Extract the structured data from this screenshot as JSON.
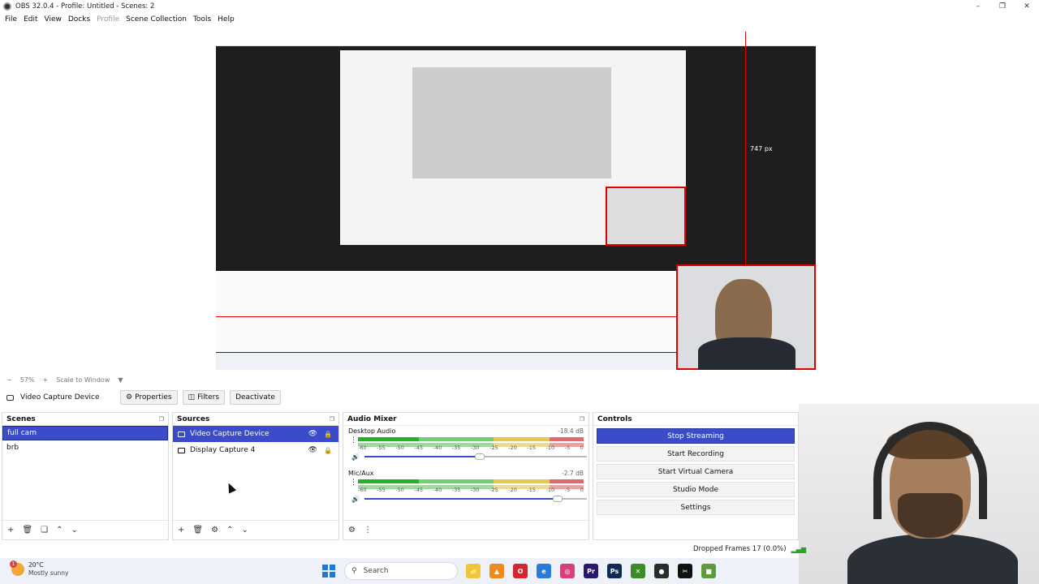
{
  "window": {
    "title": "OBS 32.0.4 - Profile: Untitled - Scenes: 2",
    "controls": [
      "–",
      "❐",
      "✕"
    ]
  },
  "menu": {
    "items": [
      "File",
      "Edit",
      "View",
      "Docks",
      "Profile",
      "Scene Collection",
      "Tools",
      "Help"
    ]
  },
  "preview": {
    "measure_label": "747 px"
  },
  "zoom_bar": {
    "minus": "−",
    "zoom": "57%",
    "plus": "+",
    "mode": "Scale to Window",
    "arrow": "▼"
  },
  "source_toolbar": {
    "source_name": "Video Capture Device",
    "properties": "Properties",
    "filters": "Filters",
    "deactivate": "Deactivate"
  },
  "scenes": {
    "title": "Scenes",
    "items": [
      "full cam",
      "brb"
    ],
    "footer": [
      "+",
      "🗑",
      "❏",
      "⌃",
      "⌄"
    ]
  },
  "sources": {
    "title": "Sources",
    "items": [
      "Video Capture Device",
      "Display Capture 4"
    ],
    "footer": [
      "+",
      "🗑",
      "⚙",
      "⌃",
      "⌄"
    ]
  },
  "mixer": {
    "title": "Audio Mixer",
    "channels": [
      {
        "name": "Desktop Audio",
        "db": "-18.4 dB",
        "level": 0.27,
        "volume": 0.52
      },
      {
        "name": "Mic/Aux",
        "db": "-2.7 dB",
        "level": 0.27,
        "volume": 0.87
      }
    ],
    "ticks": [
      "-60",
      "-55",
      "-50",
      "-45",
      "-40",
      "-35",
      "-30",
      "-25",
      "-20",
      "-15",
      "-10",
      "-5",
      "0"
    ],
    "footer": [
      "⚙",
      "⋮"
    ]
  },
  "controls": {
    "title": "Controls",
    "buttons": [
      "Stop Streaming",
      "Start Recording",
      "Start Virtual Camera",
      "Studio Mode",
      "Settings"
    ]
  },
  "status": {
    "dropped": "Dropped Frames 17 (0.0%)"
  },
  "taskbar": {
    "weather_temp": "20°C",
    "weather_cond": "Mostly sunny",
    "badge": "1",
    "search": "Search",
    "icons": [
      {
        "name": "file-explorer-icon",
        "label": "📁",
        "color": "#f2c43c"
      },
      {
        "name": "vlc-icon",
        "label": "▲",
        "color": "#f08a1c"
      },
      {
        "name": "opera-icon",
        "label": "O",
        "color": "#d3262e"
      },
      {
        "name": "edge-icon",
        "label": "e",
        "color": "#2a7bd8"
      },
      {
        "name": "instagram-icon",
        "label": "◎",
        "color": "#d6417a"
      },
      {
        "name": "premiere-icon",
        "label": "Pr",
        "color": "#2b1670"
      },
      {
        "name": "photoshop-icon",
        "label": "Ps",
        "color": "#0f2a57"
      },
      {
        "name": "xbox-icon",
        "label": "✕",
        "color": "#3c8a2a"
      },
      {
        "name": "obs-icon",
        "label": "●",
        "color": "#2b2b2b"
      },
      {
        "name": "capcut-icon",
        "label": "✂",
        "color": "#111111"
      },
      {
        "name": "minecraft-icon",
        "label": "■",
        "color": "#5f9b3c"
      }
    ]
  }
}
